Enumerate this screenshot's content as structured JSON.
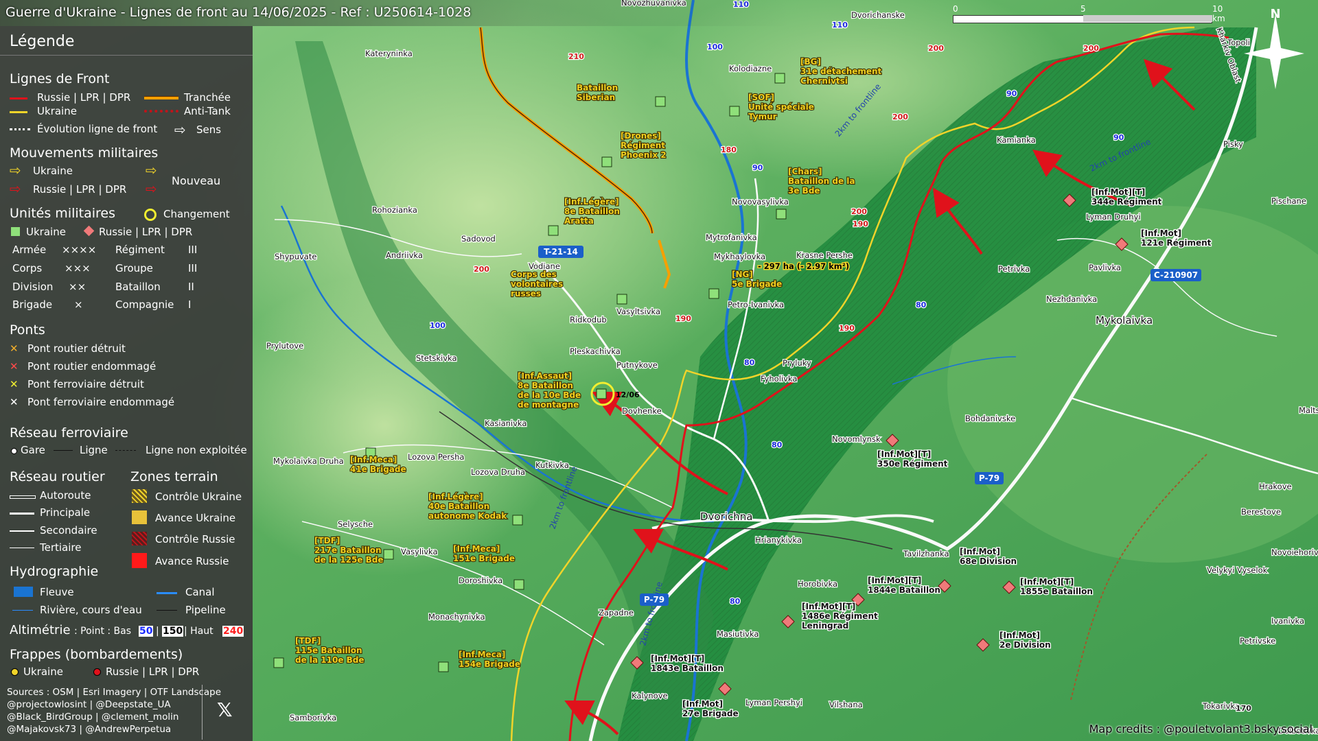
{
  "title": "Guerre d'Ukraine - Lignes de front au 14/06/2025 - Ref : U250614-1028",
  "scale": {
    "zero": "0",
    "mid": "5",
    "end": "10 km"
  },
  "north": "N",
  "credit": "Map credits : @pouletvolant3.bsky.social",
  "legend": {
    "title": "Légende",
    "front": {
      "heading": "Lignes de Front",
      "russia": "Russie | LPR | DPR",
      "ukraine": "Ukraine",
      "trench": "Tranchée",
      "antitank": "Anti-Tank",
      "evolution": "Évolution ligne de front",
      "direction": "Sens"
    },
    "moves": {
      "heading": "Mouvements militaires",
      "ukraine": "Ukraine",
      "russia": "Russie | LPR | DPR",
      "new": "Nouveau"
    },
    "units": {
      "heading": "Unités militaires",
      "change": "Changement",
      "ukraine": "Ukraine",
      "russia": "Russie | LPR | DPR",
      "rows": [
        {
          "a": "Armée",
          "as": "××××",
          "b": "Régiment",
          "bs": "III"
        },
        {
          "a": "Corps",
          "as": "×××",
          "b": "Groupe",
          "bs": "III"
        },
        {
          "a": "Division",
          "as": "××",
          "b": "Bataillon",
          "bs": "II"
        },
        {
          "a": "Brigade",
          "as": "×",
          "b": "Compagnie",
          "bs": "I"
        }
      ]
    },
    "bridges": {
      "heading": "Ponts",
      "items": [
        "Pont routier détruit",
        "Pont routier endommagé",
        "Pont ferroviaire détruit",
        "Pont ferroviaire endommagé"
      ]
    },
    "rail": {
      "heading": "Réseau ferroviaire",
      "station": "Gare",
      "line": "Ligne",
      "unused": "Ligne non exploitée"
    },
    "roads": {
      "heading": "Réseau routier",
      "items": [
        "Autoroute",
        "Principale",
        "Secondaire",
        "Tertiaire"
      ]
    },
    "zones": {
      "heading": "Zones terrain",
      "items": [
        "Contrôle Ukraine",
        "Avance Ukraine",
        "Contrôle Russie",
        "Avance Russie"
      ]
    },
    "hydro": {
      "heading": "Hydrographie",
      "river": "Fleuve",
      "canal": "Canal",
      "stream": "Rivière, cours d'eau",
      "pipeline": "Pipeline"
    },
    "alt": {
      "label": "Altimétrie",
      "rest": ": Point : Bas",
      "low": "50",
      "mid": "150",
      "sep": "| Haut",
      "high": "240"
    },
    "strikes": {
      "heading": "Frappes (bombardements)",
      "ukraine": "Ukraine",
      "russia": "Russie | LPR | DPR"
    },
    "sources": [
      "Sources : OSM | Esri Imagery | OTF Landscape",
      "@projectowlosint | @Deepstate_UA",
      "@Black_BirdGroup | @clement_molin",
      "@Majakovsk73 | @AndrewPerpetua"
    ]
  },
  "places": [
    {
      "n": "Kateryninka"
    },
    {
      "n": "Novozhuvanivka"
    },
    {
      "n": "Kolodiazne"
    },
    {
      "n": "Dvorichanske"
    },
    {
      "n": "Topoli"
    },
    {
      "n": "Rohozianka"
    },
    {
      "n": "Sadovod"
    },
    {
      "n": "Andriivka"
    },
    {
      "n": "Shypuvate"
    },
    {
      "n": "Novovasylivka"
    },
    {
      "n": "Mytrofanivka"
    },
    {
      "n": "Mykhaylovka"
    },
    {
      "n": "Krasne Pershe"
    },
    {
      "n": "Vodiane"
    },
    {
      "n": "Ridkodub"
    },
    {
      "n": "Vasyltsivka"
    },
    {
      "n": "Petro-Ivanivka"
    },
    {
      "n": "Prylutove"
    },
    {
      "n": "Stetskivka"
    },
    {
      "n": "Pleskachivka"
    },
    {
      "n": "Putnykove"
    },
    {
      "n": "Fyholivka"
    },
    {
      "n": "Dovhenke"
    },
    {
      "n": "Kasianivka"
    },
    {
      "n": "Kamianka"
    },
    {
      "n": "Pisky"
    },
    {
      "n": "Lyman Druhyi"
    },
    {
      "n": "Petrivka"
    },
    {
      "n": "Pavlivka"
    },
    {
      "n": "Nezhdanivka"
    },
    {
      "n": "Mykolaivka"
    },
    {
      "n": "Pischane"
    },
    {
      "n": "Novomlynsk"
    },
    {
      "n": "Bohdanivske"
    },
    {
      "n": "Lozova Persha"
    },
    {
      "n": "Mykolaivka Druha"
    },
    {
      "n": "Lozova Druha"
    },
    {
      "n": "Kutkivka"
    },
    {
      "n": "Dvorichna"
    },
    {
      "n": "Hrianykivka"
    },
    {
      "n": "Selysche"
    },
    {
      "n": "Vasylivka"
    },
    {
      "n": "Doroshivka"
    },
    {
      "n": "Zapadne"
    },
    {
      "n": "Horobivka"
    },
    {
      "n": "Tavilzhanka"
    },
    {
      "n": "Masiutivka"
    },
    {
      "n": "Monachynivka"
    },
    {
      "n": "Kalynove"
    },
    {
      "n": "Lyman Pershyi"
    },
    {
      "n": "Vilshana"
    },
    {
      "n": "Samborivka"
    },
    {
      "n": "Berestove"
    },
    {
      "n": "Hrakove"
    },
    {
      "n": "Novoiehorivka"
    },
    {
      "n": "Velykyi Vyselok"
    },
    {
      "n": "Ivanivka"
    },
    {
      "n": "Petrivske"
    },
    {
      "n": "Tokarivka"
    },
    {
      "n": "Dolbotivka"
    },
    {
      "n": "Malts"
    },
    {
      "n": "Kharkiv Oblast"
    },
    {
      "n": "Pryluky"
    }
  ],
  "units": [
    {
      "t": "Bataillon\nSiberian"
    },
    {
      "t": "[BG]\n31e détachement\nChernivtsi"
    },
    {
      "t": "[SOF]\nUnité spéciale\nTymur"
    },
    {
      "t": "[Drones]\nRégiment\nPhoenix 2"
    },
    {
      "t": "[Chars]\nBataillon de la\n3e Bde"
    },
    {
      "t": "[Inf.Légère]\n8e Bataillon\nAratta"
    },
    {
      "t": "Corps des\nvolontaires\nrusses"
    },
    {
      "t": "[NG]\n5e Brigade"
    },
    {
      "t": "[Inf.Assaut]\n8e Bataillon\nde la 10e Bde\nde montagne"
    },
    {
      "t": "[Inf.Meca]\n41e Brigade"
    },
    {
      "t": "[Inf.Légère]\n40e Bataillon\nautonome Kodak"
    },
    {
      "t": "[TDF]\n217e Bataillon\nde la 125e Bde"
    },
    {
      "t": "[Inf.Meca]\n151e Brigade"
    },
    {
      "t": "[TDF]\n115e Bataillon\nde la 110e Bde"
    },
    {
      "t": "[Inf.Meca]\n154e Brigade"
    },
    {
      "t": "[Inf.Mot][T]\n344e Régiment"
    },
    {
      "t": "[Inf.Mot]\n121e Régiment"
    },
    {
      "t": "[Inf.Mot][T]\n350e Régiment"
    },
    {
      "t": "[Inf.Mot]\n68e Division"
    },
    {
      "t": "[Inf.Mot][T]\n1844e Bataillon"
    },
    {
      "t": "[Inf.Mot][T]\n1855e Bataillon"
    },
    {
      "t": "[Inf.Mot][T]\n1486e Régiment\nLeningrad"
    },
    {
      "t": "[Inf.Mot]\n2e Division"
    },
    {
      "t": "[Inf.Mot][T]\n1843e Bataillon"
    },
    {
      "t": "[Inf.Mot]\n27e Brigade"
    }
  ],
  "annotations": [
    "12/06",
    "- 297 ha (- 2.97 km²)"
  ],
  "road_labels": [
    "T-21-14",
    "C-210907",
    "P-79",
    "P-79"
  ],
  "frontline_notes": [
    "2km to frontline",
    "2km to frontline",
    "2km to frontline",
    "2km to frontline"
  ],
  "altitudes": [
    "210",
    "200",
    "200",
    "200",
    "200",
    "180",
    "190",
    "190",
    "190",
    "200",
    "110",
    "110",
    "100",
    "100",
    "90",
    "90",
    "90",
    "80",
    "80",
    "80",
    "80",
    "170"
  ],
  "colors": {
    "russia": "#e0121b",
    "ukraine": "#f1d42a",
    "panel": "#3a3a3a",
    "water": "#1a74d2"
  }
}
